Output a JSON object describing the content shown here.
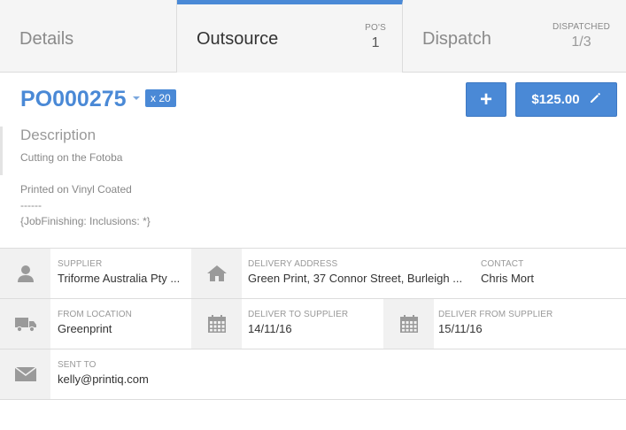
{
  "tabs": [
    {
      "label": "Details"
    },
    {
      "label": "Outsource",
      "count_caption": "PO'S",
      "count": "1"
    },
    {
      "label": "Dispatch",
      "count_caption": "DISPATCHED",
      "count": "1/3"
    }
  ],
  "header": {
    "po_number": "PO000275",
    "qty_badge": "x 20",
    "add_label": "+",
    "price_label": "$125.00"
  },
  "description": {
    "title": "Description",
    "lines": [
      "Cutting on the Fotoba",
      "Printed on Vinyl Coated",
      "------",
      "{JobFinishing: Inclusions: *}"
    ]
  },
  "fields": {
    "supplier": {
      "label": "SUPPLIER",
      "value": "Triforme Australia Pty ..."
    },
    "delivery_address": {
      "label": "DELIVERY ADDRESS",
      "value": "Green Print, 37 Connor Street, Burleigh ..."
    },
    "contact": {
      "label": "CONTACT",
      "value": "Chris Mort"
    },
    "from_location": {
      "label": "FROM LOCATION",
      "value": "Greenprint"
    },
    "deliver_to_supplier": {
      "label": "DELIVER TO SUPPLIER",
      "value": "14/11/16"
    },
    "deliver_from_supplier": {
      "label": "DELIVER FROM SUPPLIER",
      "value": "15/11/16"
    },
    "sent_to": {
      "label": "SENT TO",
      "value": "kelly@printiq.com"
    }
  },
  "colors": {
    "accent": "#4a89d6",
    "icon_bg": "#f1f1f1",
    "icon": "#9a9a9a"
  },
  "icons": [
    "user-icon",
    "home-icon",
    "truck-icon",
    "calendar-icon",
    "envelope-icon",
    "pencil-icon",
    "plus-icon",
    "caret-down-icon"
  ]
}
